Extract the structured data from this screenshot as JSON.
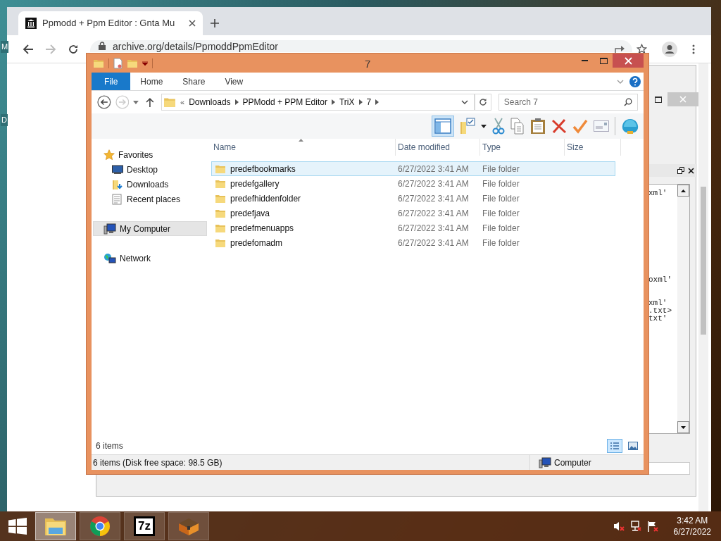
{
  "desktop": {
    "icon_labels": [
      "M",
      "D"
    ]
  },
  "browser": {
    "tab": {
      "title": "Ppmodd + Ppm Editor : Gnta Mu",
      "selected": true
    },
    "url": "archive.org/details/PpmoddPpmEditor"
  },
  "editor_window": {
    "code_lines": [
      "xml'",
      "oxml'",
      "xml'",
      ".txt>",
      "txt'"
    ]
  },
  "explorer": {
    "title": "7",
    "ribbon_tabs": [
      {
        "label": "File",
        "selected": true
      },
      {
        "label": "Home",
        "selected": false
      },
      {
        "label": "Share",
        "selected": false
      },
      {
        "label": "View",
        "selected": false
      }
    ],
    "breadcrumb_prefix": "«",
    "breadcrumb": [
      "Downloads",
      "PPModd + PPM Editor",
      "TriX",
      "7"
    ],
    "search": {
      "placeholder": "Search 7"
    },
    "nav": [
      {
        "label": "Favorites",
        "selected": false,
        "children": [
          {
            "label": "Desktop",
            "selected": false
          },
          {
            "label": "Downloads",
            "selected": false
          },
          {
            "label": "Recent places",
            "selected": false
          }
        ]
      },
      {
        "label": "My Computer",
        "selected": true
      },
      {
        "label": "Network",
        "selected": false
      }
    ],
    "columns": [
      "Name",
      "Date modified",
      "Type",
      "Size"
    ],
    "files": [
      {
        "name": "predefbookmarks",
        "date": "6/27/2022 3:41 AM",
        "type": "File folder",
        "selected": true
      },
      {
        "name": "predefgallery",
        "date": "6/27/2022 3:41 AM",
        "type": "File folder",
        "selected": false
      },
      {
        "name": "predefhiddenfolder",
        "date": "6/27/2022 3:41 AM",
        "type": "File folder",
        "selected": false
      },
      {
        "name": "predefjava",
        "date": "6/27/2022 3:41 AM",
        "type": "File folder",
        "selected": false
      },
      {
        "name": "predefmenuapps",
        "date": "6/27/2022 3:41 AM",
        "type": "File folder",
        "selected": false
      },
      {
        "name": "predefomadm",
        "date": "6/27/2022 3:41 AM",
        "type": "File folder",
        "selected": false
      }
    ],
    "item_count": "6 items",
    "view_buttons": [
      {
        "kind": "details",
        "selected": true
      },
      {
        "kind": "thumbnails",
        "selected": false
      }
    ],
    "status": {
      "text": "6 items (Disk free space: 98.5 GB)",
      "location": "Computer"
    }
  },
  "taskbar": {
    "apps": [
      {
        "kind": "explorer",
        "active": true
      },
      {
        "kind": "chrome",
        "active": false
      },
      {
        "kind": "archiver",
        "label": "7z",
        "active": false
      },
      {
        "kind": "chest",
        "active": false
      }
    ],
    "time": "3:42 AM",
    "date": "6/27/2022"
  }
}
